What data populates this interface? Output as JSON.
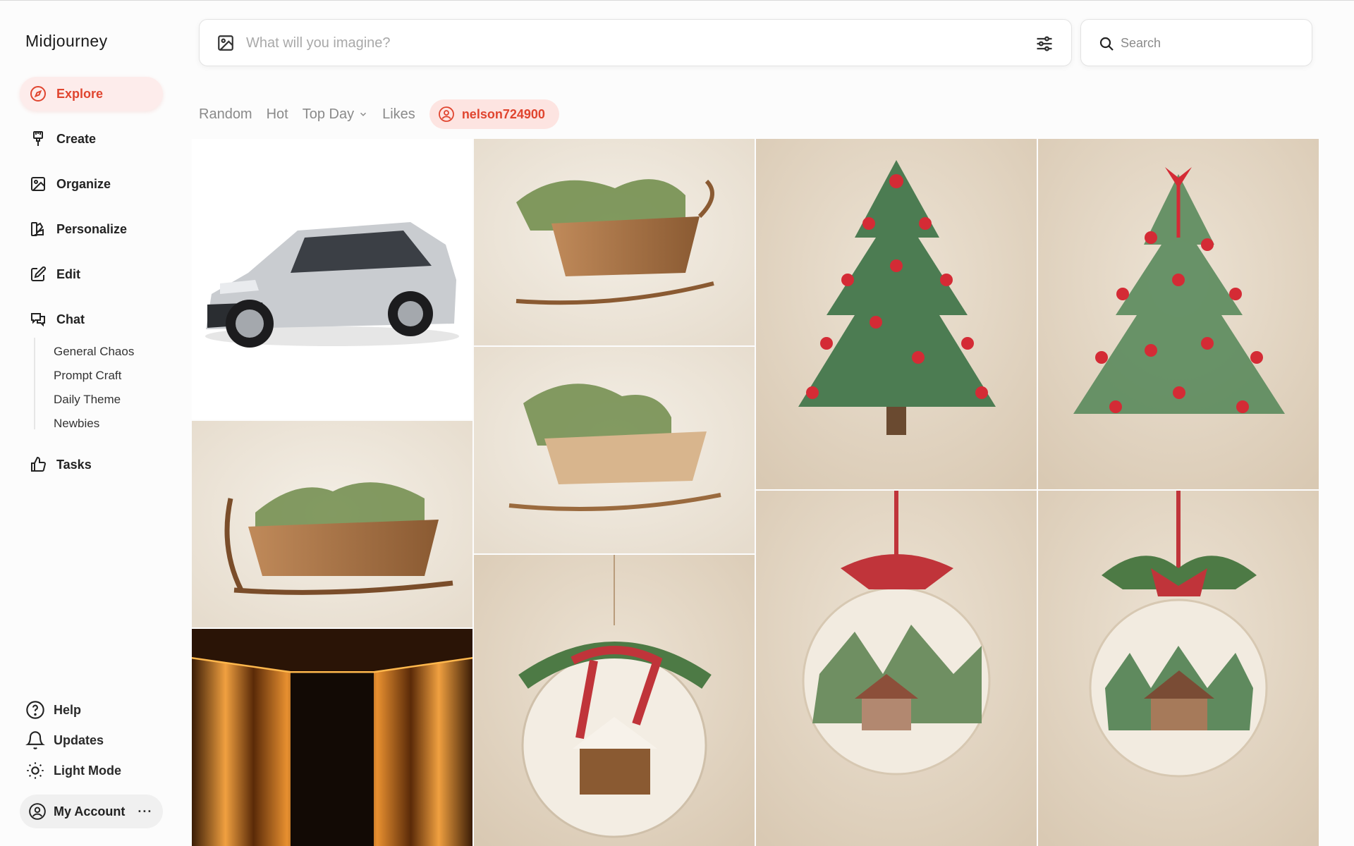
{
  "app": {
    "title": "Midjourney"
  },
  "sidebar": {
    "items": [
      {
        "label": "Explore",
        "icon": "compass-icon",
        "active": true
      },
      {
        "label": "Create",
        "icon": "brush-icon"
      },
      {
        "label": "Organize",
        "icon": "image-icon"
      },
      {
        "label": "Personalize",
        "icon": "swatch-icon"
      },
      {
        "label": "Edit",
        "icon": "edit-icon"
      },
      {
        "label": "Chat",
        "icon": "chat-icon"
      },
      {
        "label": "Tasks",
        "icon": "thumbs-up-icon"
      }
    ],
    "chat_channels": [
      "General Chaos",
      "Prompt Craft",
      "Daily Theme",
      "Newbies"
    ],
    "bottom": [
      {
        "label": "Help",
        "icon": "help-icon"
      },
      {
        "label": "Updates",
        "icon": "bell-icon"
      },
      {
        "label": "Light Mode",
        "icon": "sun-icon"
      }
    ],
    "account": {
      "label": "My Account",
      "icon": "user-circle-icon",
      "more": "···"
    }
  },
  "prompt": {
    "placeholder": "What will you imagine?",
    "value": ""
  },
  "search": {
    "placeholder": "Search",
    "value": ""
  },
  "tabs": {
    "items": [
      "Random",
      "Hot",
      "Top Day",
      "Likes"
    ],
    "user": "nelson724900"
  },
  "gallery": {
    "items": [
      "silver-suv",
      "sleigh-with-tree-1",
      "christmas-tree-bows-1",
      "christmas-tree-bows-2",
      "sleigh-with-tree-2",
      "sleigh-with-tree-3",
      "ornament-cabin-1",
      "ornament-cabin-2",
      "amber-corridor",
      "ornament-cabin-3"
    ]
  },
  "colors": {
    "accent": "#e0452f",
    "accent_bg": "#fdeceb"
  }
}
